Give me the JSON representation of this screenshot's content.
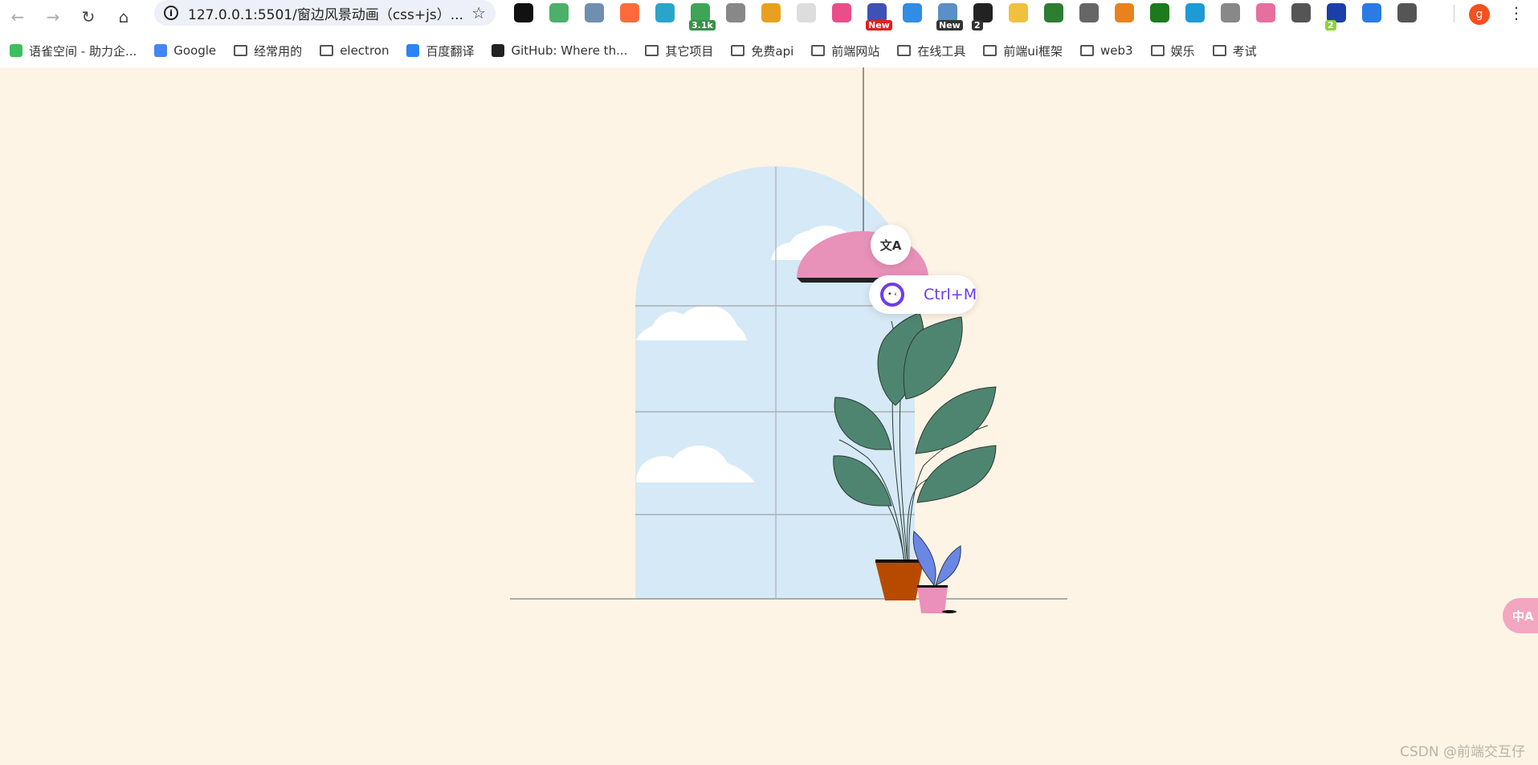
{
  "browser": {
    "url": "127.0.0.1:5501/窗边风景动画（css+js）...",
    "extensions": [
      {
        "name": "ext-1",
        "color": "#111111"
      },
      {
        "name": "ext-adguard",
        "color": "#4caf6a"
      },
      {
        "name": "ext-star",
        "color": "#6f8fb0"
      },
      {
        "name": "ext-orange",
        "color": "#ff6a3d"
      },
      {
        "name": "ext-colorful",
        "color": "#2aa5c9"
      },
      {
        "name": "ext-counter",
        "color": "#3da557",
        "badge": "3.1k",
        "badge_color": "#3a8f4a"
      },
      {
        "name": "ext-face",
        "color": "#888888"
      },
      {
        "name": "ext-ring",
        "color": "#e9a020"
      },
      {
        "name": "ext-grey",
        "color": "#dddddd"
      },
      {
        "name": "ext-translate",
        "color": "#e84f8a"
      },
      {
        "name": "ext-new-red",
        "color": "#3f51b5",
        "badge": "New",
        "badge_color": "#e02020"
      },
      {
        "name": "ext-screenshot",
        "color": "#2f8de4"
      },
      {
        "name": "ext-new-white",
        "color": "#5a8fc8",
        "badge": "New",
        "badge_color": "#333333"
      },
      {
        "name": "ext-dark",
        "color": "#222222",
        "badge": "2",
        "badge_color": "#333333"
      },
      {
        "name": "ext-y",
        "color": "#f0c040"
      },
      {
        "name": "ext-chrome",
        "color": "#2e7d32"
      },
      {
        "name": "ext-copy",
        "color": "#666666"
      },
      {
        "name": "ext-fox",
        "color": "#e8821e"
      },
      {
        "name": "ext-download",
        "color": "#1b7a1b"
      },
      {
        "name": "ext-eye",
        "color": "#1e9ad6"
      },
      {
        "name": "ext-n",
        "color": "#888888"
      },
      {
        "name": "ext-confetti",
        "color": "#e66fa0"
      },
      {
        "name": "ext-a",
        "color": "#555555"
      },
      {
        "name": "ext-blue",
        "color": "#1a3fa8",
        "badge": "2",
        "badge_color": "#8cd33a"
      },
      {
        "name": "ext-ghost",
        "color": "#2a7be4"
      },
      {
        "name": "ext-puzzle",
        "color": "#555555"
      }
    ],
    "avatar_letter": "g"
  },
  "bookmarks": [
    {
      "label": "语雀空间 - 助力企...",
      "icon": "yuque",
      "color": "#3bbf5f"
    },
    {
      "label": "Google",
      "icon": "google",
      "color": "#4285f4"
    },
    {
      "label": "经常用的",
      "icon": "folder"
    },
    {
      "label": "electron",
      "icon": "folder"
    },
    {
      "label": "百度翻译",
      "icon": "baidu-translate",
      "color": "#2b83f6"
    },
    {
      "label": "GitHub: Where th...",
      "icon": "github",
      "color": "#222222"
    },
    {
      "label": "其它项目",
      "icon": "folder"
    },
    {
      "label": "免费api",
      "icon": "folder"
    },
    {
      "label": "前端网站",
      "icon": "folder"
    },
    {
      "label": "在线工具",
      "icon": "folder"
    },
    {
      "label": "前端ui框架",
      "icon": "folder"
    },
    {
      "label": "web3",
      "icon": "folder"
    },
    {
      "label": "娱乐",
      "icon": "folder"
    },
    {
      "label": "考试",
      "icon": "folder"
    }
  ],
  "overlay": {
    "translate_glyph": "文A",
    "shortcut_label": "Ctrl+M",
    "side_translate_glyph": "中A"
  },
  "watermark": "CSDN @前端交互仔",
  "colors": {
    "background": "#fdf4e5",
    "sky": "#d6e9f6",
    "lamp": "#e891b9",
    "leaf": "#4e8571",
    "pot": "#b84a00",
    "small_pot": "#ea90bb",
    "small_leaf": "#6b87e4",
    "accent": "#6b3cf0"
  }
}
